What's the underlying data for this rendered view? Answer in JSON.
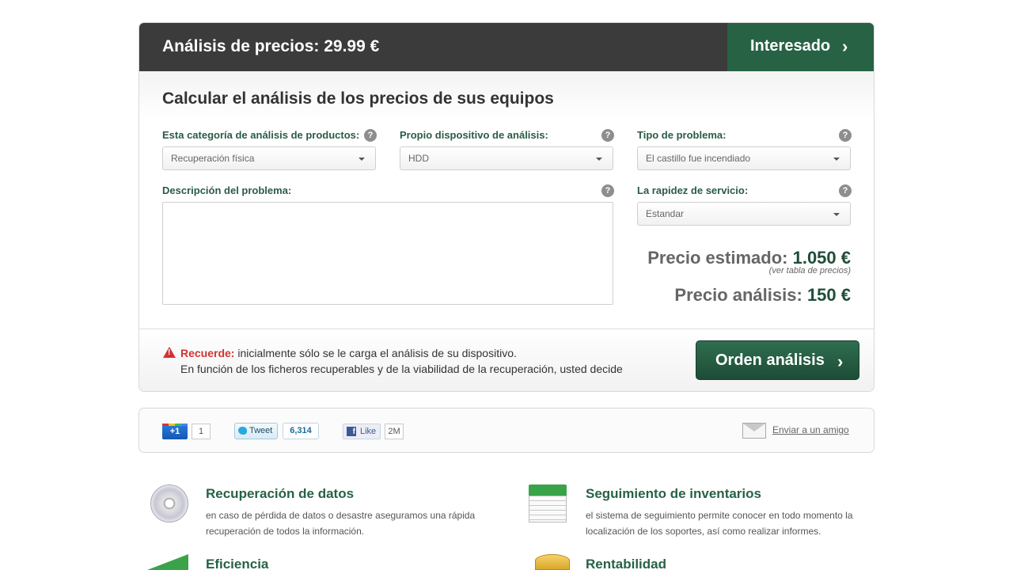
{
  "header": {
    "title": "Análisis de precios: 29.99 €",
    "interest_button": "Interesado",
    "chevron": "›"
  },
  "form": {
    "section_title": "Calcular el análisis de los precios de sus equipos",
    "help_glyph": "?",
    "category": {
      "label": "Esta categoría de análisis de productos:",
      "value": "Recuperación física"
    },
    "device": {
      "label": "Propio dispositivo de análisis:",
      "value": "HDD"
    },
    "problem_type": {
      "label": "Tipo de problema:",
      "value": "El castillo fue incendiado"
    },
    "description": {
      "label": "Descripción del problema:",
      "value": ""
    },
    "speed": {
      "label": "La rapidez de servicio:",
      "value": "Estandar"
    }
  },
  "prices": {
    "estimated_label": "Precio estimado:",
    "estimated_value": "1.050 €",
    "table_link": "(ver tabla de precios)",
    "analysis_label": "Precio análisis:",
    "analysis_value": "150 €"
  },
  "notice": {
    "strong": "Recuerde:",
    "line1": " inicialmente sólo se le carga el análisis de su dispositivo.",
    "line2": "En función de los ficheros recuperables y de la viabilidad de la recuperación, usted decide",
    "order_button": "Orden análisis",
    "icon": "warning-icon"
  },
  "social": {
    "gplus_label": "+1",
    "gplus_count": "1",
    "tweet_label": "Tweet",
    "tweet_count": "6,314",
    "like_glyph": "f",
    "like_label": "Like",
    "like_count": "2M",
    "email_link": "Enviar a un amigo"
  },
  "features": [
    {
      "title": "Recuperación de datos",
      "desc": "en caso de pérdida de datos o desastre aseguramos una rápida recuperación de todos la información.",
      "icon": "disc-icon"
    },
    {
      "title": "Seguimiento de inventarios",
      "desc": "el sistema de seguimiento permite conocer en todo momento la localización de los soportes, así como realizar informes.",
      "icon": "document-icon"
    },
    {
      "title": "Eficiencia",
      "desc": "",
      "icon": "chart-icon"
    },
    {
      "title": "Rentabilidad",
      "desc": "",
      "icon": "coins-icon"
    }
  ],
  "colors": {
    "accent_green": "#276245",
    "header_dark": "#3b3b3b",
    "label_green": "#2a5c45",
    "warning_red": "#d33333"
  }
}
